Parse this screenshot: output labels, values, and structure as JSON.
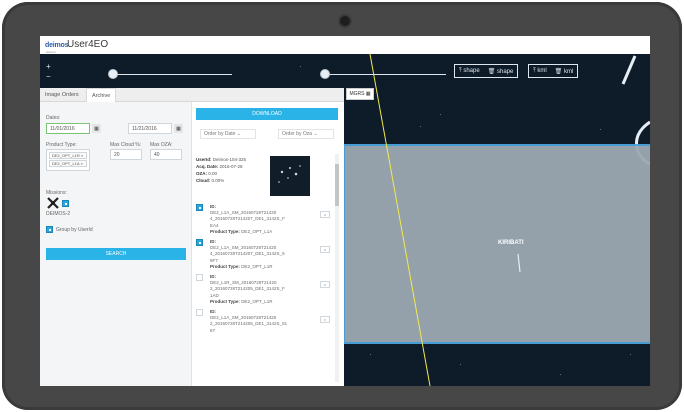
{
  "app": {
    "logo_text": "deimos",
    "logo_subtitle": "elecnor group",
    "title": "User4EO"
  },
  "map": {
    "zoom_in": "+",
    "zoom_out": "−",
    "shape_group": [
      {
        "icon": "upload-icon",
        "label": "shape"
      },
      {
        "icon": "trash-icon",
        "label": "shape"
      }
    ],
    "kml_group": [
      {
        "icon": "upload-icon",
        "label": "kml"
      },
      {
        "icon": "trash-icon",
        "label": "kml"
      }
    ],
    "mgrs_button": "MGRS",
    "area_label": "KIRIBATI",
    "colors": {
      "area_fill": "#9ca9b1",
      "area_border": "#4aa3df",
      "line": "#f2e94e"
    }
  },
  "tabs": [
    {
      "label": "Image Orders",
      "active": false
    },
    {
      "label": "Archive",
      "active": true
    }
  ],
  "search": {
    "dates_label": "Dates:",
    "date_from": "11/01/2016",
    "date_to": "11/21/2016",
    "product_type_label": "Product Type:",
    "product_types": [
      "DE2_OPT_L1R ×",
      "DE2_OPT_L1A ×"
    ],
    "max_cloud_label": "Max Cloud %:",
    "max_cloud_value": "20",
    "max_ozn_label": "Max OZA:",
    "max_ozn_value": "40",
    "missions_label": "Missions:",
    "mission_name": "DEIMOS-2",
    "group_label": "Group by UserId",
    "search_button": "SEARCH"
  },
  "results": {
    "download_button": "DOWNLOAD",
    "order_by_date": "Order by Date",
    "order_by_oza": "Order by Oza",
    "detail": [
      {
        "key": "UserId:",
        "value": "Deimos-104-325"
      },
      {
        "key": "Acq. Date:",
        "value": "2016-07-28"
      },
      {
        "key": "OZA:",
        "value": "0.00"
      },
      {
        "key": "Cloud:",
        "value": "0.00%"
      }
    ],
    "items": [
      {
        "checked": true,
        "id_label": "ID:",
        "id": "DE2_L1A_SM_20160728T2142025_201607...",
        "id_line1": "DE2_L1A_SM_20160728T21420",
        "id_line2": "4_20160728T214207_DE1_3142S_F",
        "id_line3": "EA4",
        "type_label": "Product Type:",
        "type": "DE2_OPT_L1A"
      },
      {
        "checked": true,
        "id_label": "ID:",
        "id_line1": "DE2_L1A_SM_20160728T21420",
        "id_line2": "4_20160728T214207_DE1_3142S_5",
        "id_line3": "8F7",
        "type_label": "Product Type:",
        "type": "DE2_OPT_L1R"
      },
      {
        "checked": false,
        "id_label": "ID:",
        "id_line1": "DE2_L1R_SM_20160728T21420",
        "id_line2": "2_20160728T214205_DE1_3142S_F",
        "id_line3": "1AD",
        "type_label": "Product Type:",
        "type": "DE2_OPT_L1R"
      },
      {
        "checked": false,
        "id_label": "ID:",
        "id_line1": "DE2_L1A_SM_20160728T21420",
        "id_line2": "2_20160728T214205_DE1_3142S_81",
        "id_line3": "67",
        "type_label": "",
        "type": ""
      }
    ]
  }
}
